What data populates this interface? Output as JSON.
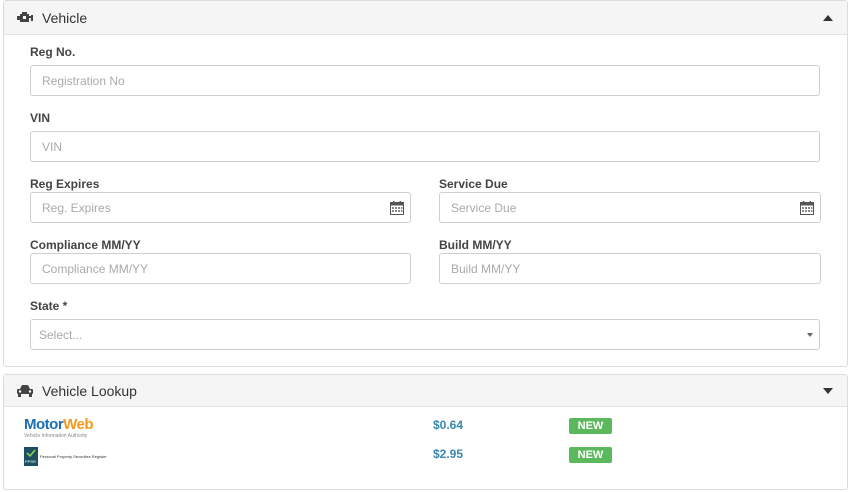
{
  "vehicle": {
    "title": "Vehicle",
    "fields": {
      "reg_no": {
        "label": "Reg No.",
        "placeholder": "Registration No"
      },
      "vin": {
        "label": "VIN",
        "placeholder": "VIN"
      },
      "reg_expires": {
        "label": "Reg Expires",
        "placeholder": "Reg. Expires"
      },
      "service_due": {
        "label": "Service Due",
        "placeholder": "Service Due"
      },
      "compliance": {
        "label": "Compliance MM/YY",
        "placeholder": "Compliance MM/YY"
      },
      "build": {
        "label": "Build MM/YY",
        "placeholder": "Build MM/YY"
      },
      "state": {
        "label": "State *",
        "value": "Select..."
      }
    }
  },
  "lookup": {
    "title": "Vehicle Lookup",
    "providers": [
      {
        "name_a": "Motor",
        "name_b": "Web",
        "tagline": "Vehicle Information Authority",
        "price": "$0.64",
        "badge": "NEW"
      },
      {
        "name": "PPSR",
        "tagline": "Personal Property Securities Register",
        "price": "$2.95",
        "badge": "NEW"
      }
    ]
  },
  "colors": {
    "accent_price": "#3a87ad",
    "badge_green": "#5cb85c",
    "header_bg": "#f5f5f5"
  },
  "icons": {
    "vehicle_header": "engine-icon",
    "lookup_header": "car-icon",
    "date": "calendar-icon"
  }
}
